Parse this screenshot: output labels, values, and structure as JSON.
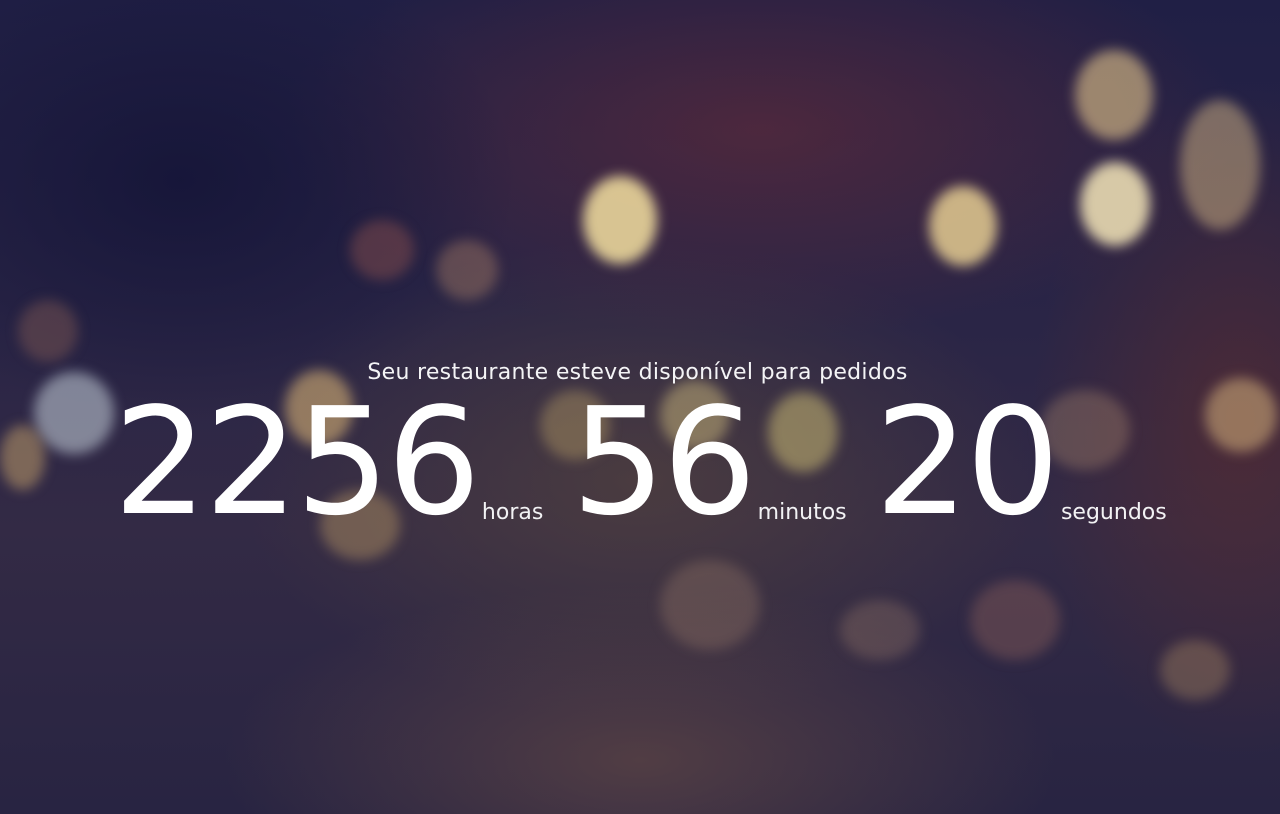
{
  "uptime": {
    "message": "Seu restaurante esteve disponível para pedidos",
    "hours": {
      "value": "2256",
      "label": "horas"
    },
    "minutes": {
      "value": "56",
      "label": "minutos"
    },
    "seconds": {
      "value": "20",
      "label": "segundos"
    }
  },
  "theme": {
    "background": "#27243f",
    "text": "#ffffff",
    "bokeh_warm": "#f3dc9a",
    "bokeh_cool": "#c8d4dc"
  }
}
